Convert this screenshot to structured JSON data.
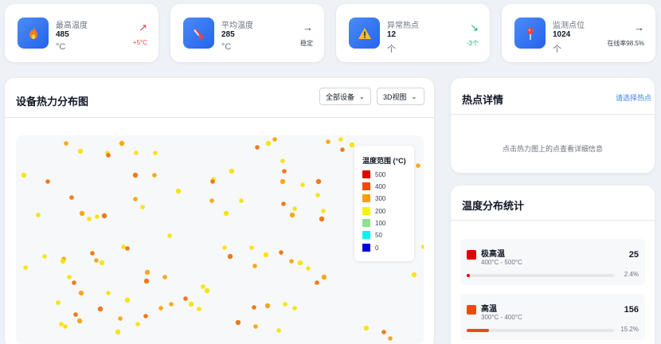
{
  "stats": [
    {
      "label": "最高温度",
      "value": "485",
      "unit": "°C",
      "trend_icon": "↗",
      "trend_value": "+5°C",
      "trend": "up",
      "icon": "flame-icon"
    },
    {
      "label": "平均温度",
      "value": "285",
      "unit": "°C",
      "trend_icon": "→",
      "trend_value": "稳定",
      "trend": "flat",
      "icon": "thermometer-icon"
    },
    {
      "label": "异常热点",
      "value": "12",
      "unit": "个",
      "trend_icon": "↘",
      "trend_value": "-3个",
      "trend": "down",
      "icon": "warning-icon"
    },
    {
      "label": "监测点位",
      "value": "1024",
      "unit": "个",
      "trend_icon": "→",
      "trend_value": "在线率98.5%",
      "trend": "flat",
      "icon": "pin-icon"
    }
  ],
  "heatmap": {
    "title": "设备热力分布图",
    "device_select": "全部设备",
    "view_select": "3D视图",
    "legend_title": "温度范围 (°C)",
    "legend": [
      {
        "label": "500",
        "color": "#e00000"
      },
      {
        "label": "400",
        "color": "#f04a00"
      },
      {
        "label": "300",
        "color": "#f5a000"
      },
      {
        "label": "200",
        "color": "#f5f500"
      },
      {
        "label": "100",
        "color": "#90e090"
      },
      {
        "label": "50",
        "color": "#00f5f0"
      },
      {
        "label": "0",
        "color": "#0000d8"
      }
    ]
  },
  "detail": {
    "title": "热点详情",
    "link": "请选择热点",
    "hint": "点击热力图上的点查看详细信息"
  },
  "distribution": {
    "title": "温度分布统计",
    "rows": [
      {
        "name": "极高温",
        "range": "400°C - 500°C",
        "count": "25",
        "percent": "2.4%",
        "fraction": 0.024,
        "color": "#e00000"
      },
      {
        "name": "高温",
        "range": "300°C - 400°C",
        "count": "156",
        "percent": "15.2%",
        "fraction": 0.152,
        "color": "#f04a00"
      }
    ]
  }
}
